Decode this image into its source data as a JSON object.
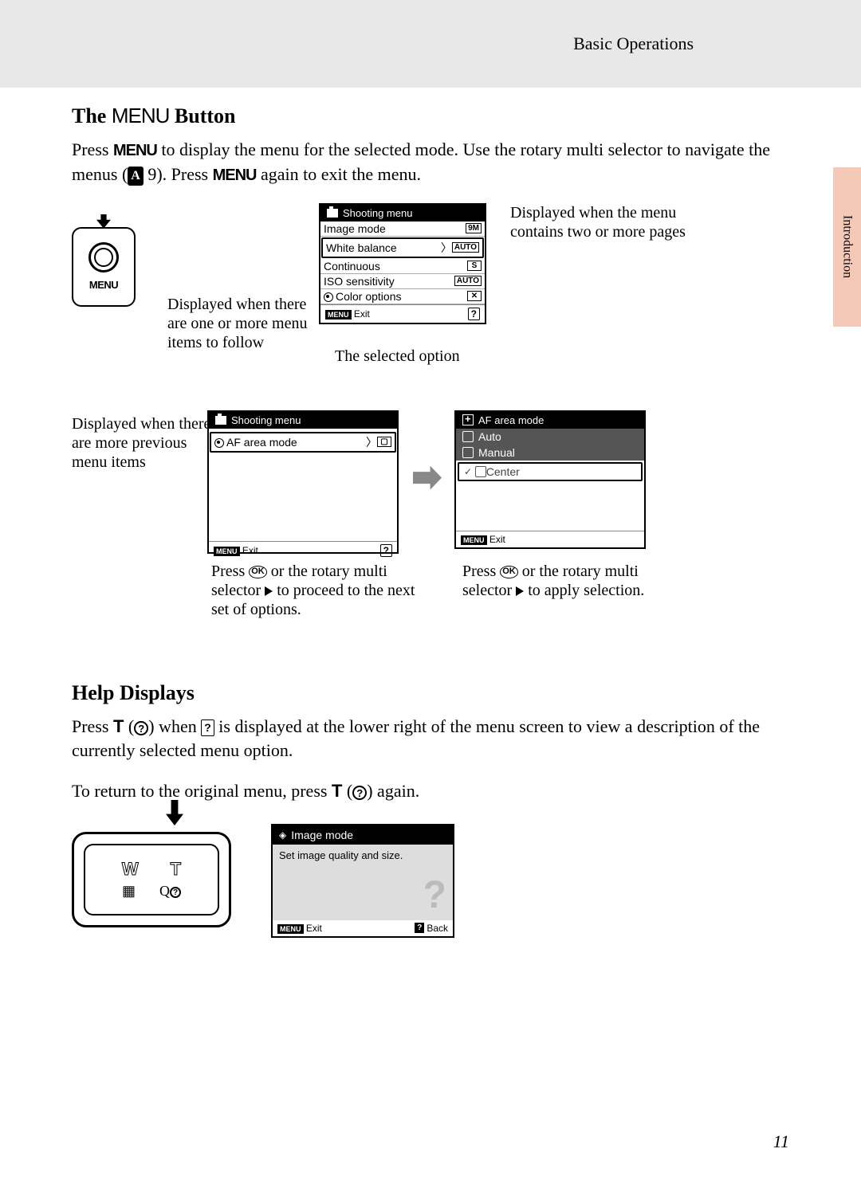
{
  "header": {
    "section": "Basic Operations"
  },
  "side_tab": "Introduction",
  "title1_pre": "The ",
  "title1_menu": "MENU",
  "title1_post": " Button",
  "para1_a": "Press ",
  "para1_b": " to display the menu for the selected mode. Use the rotary multi selector to navigate the menus (",
  "para1_c": " 9). Press ",
  "para1_d": " again to exit the menu.",
  "menu_btn_label": "MENU",
  "annot1": "Displayed when the menu contains two or more pages",
  "annot2": "Displayed when there are one or more menu items to follow",
  "annot3": "The selected option",
  "annot4": "Displayed when there are more previous menu items",
  "lcd1": {
    "title": "Shooting menu",
    "items": [
      {
        "label": "Image mode",
        "val": "9M"
      },
      {
        "label": "White balance",
        "val": "AUTO",
        "sel": true
      },
      {
        "label": "Continuous",
        "val": "S"
      },
      {
        "label": "ISO sensitivity",
        "val": "AUTO"
      },
      {
        "label": "Color options",
        "val": "✕"
      }
    ],
    "exit": "Exit"
  },
  "lcd2": {
    "title": "Shooting menu",
    "item": "AF area mode",
    "exit": "Exit"
  },
  "lcd3": {
    "title": "AF area mode",
    "options": [
      "Auto",
      "Manual",
      "Center"
    ],
    "exit": "Exit"
  },
  "annot5_a": "Press ",
  "annot5_b": " or the rotary multi selector ",
  "annot5_c": " to proceed to the next set of options.",
  "annot6_a": "Press ",
  "annot6_b": " or the rotary multi selector ",
  "annot6_c": " to apply selection.",
  "title2": "Help Displays",
  "para2_a": "Press ",
  "para2_b": " (",
  "para2_c": ") when ",
  "para2_d": " is displayed at the lower right of the menu screen to view a description of the currently selected menu option.",
  "para3_a": "To return to the original menu, press ",
  "para3_b": " (",
  "para3_c": ") again.",
  "help_screen": {
    "title": "Image mode",
    "body": "Set image quality and size.",
    "exit": "Exit",
    "back": "Back"
  },
  "zoom": {
    "w": "W",
    "t": "T"
  },
  "page_number": "11",
  "T_letter": "T",
  "help_q": "?",
  "ok_label": "OK",
  "ref_icon": "A"
}
